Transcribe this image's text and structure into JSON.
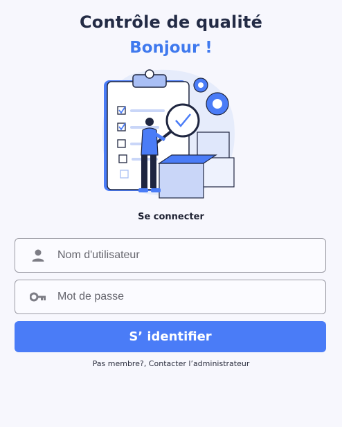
{
  "header": {
    "title": "Contrôle de qualité",
    "greeting": "Bonjour !"
  },
  "illustration": {
    "icon": "quality-control-illustration",
    "accent_color": "#4a7cf7"
  },
  "login": {
    "subtitle": "Se connecter",
    "username_placeholder": "Nom d'utilisateur",
    "username_value": "",
    "username_icon": "person-icon",
    "password_placeholder": "Mot de passe",
    "password_value": "",
    "password_icon": "key-icon",
    "submit_label": "S’ identifier",
    "submit_color": "#4a7cf7",
    "footer_text": "Pas membre?, Contacter l’administrateur"
  },
  "colors": {
    "background": "#f7f7fd",
    "title": "#232b45",
    "greeting": "#3f79ee"
  }
}
